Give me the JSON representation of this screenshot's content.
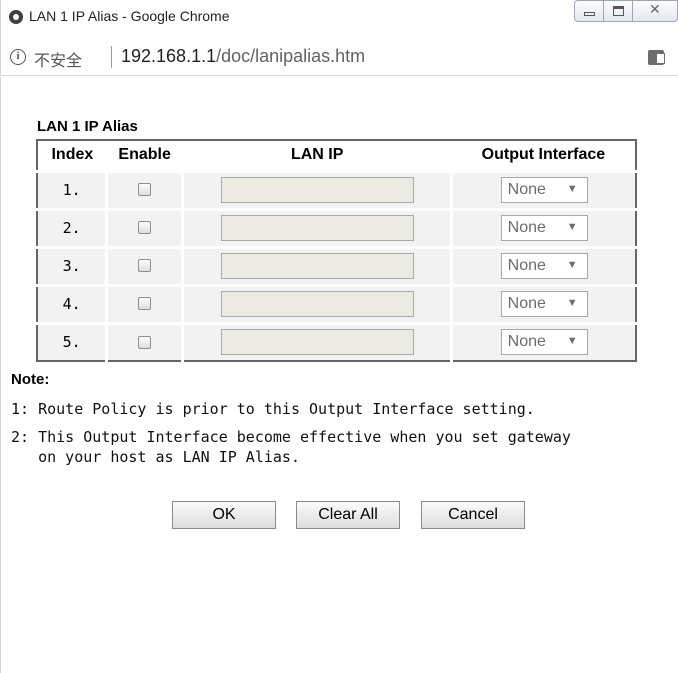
{
  "window": {
    "title": "LAN 1 IP Alias - Google Chrome",
    "minimize_label": "",
    "close_glyph": "✕"
  },
  "addressbar": {
    "security_text": "不安全",
    "url_host": "192.168.1.1",
    "url_path": "/doc/lanipalias.htm"
  },
  "page": {
    "section_title": "LAN 1 IP Alias",
    "columns": {
      "index": "Index",
      "enable": "Enable",
      "lan_ip": "LAN IP",
      "output": "Output Interface"
    },
    "rows": [
      {
        "index": "1.",
        "enabled": false,
        "lan_ip": "",
        "output": "None"
      },
      {
        "index": "2.",
        "enabled": false,
        "lan_ip": "",
        "output": "None"
      },
      {
        "index": "3.",
        "enabled": false,
        "lan_ip": "",
        "output": "None"
      },
      {
        "index": "4.",
        "enabled": false,
        "lan_ip": "",
        "output": "None"
      },
      {
        "index": "5.",
        "enabled": false,
        "lan_ip": "",
        "output": "None"
      }
    ],
    "note_title": "Note:",
    "note1": "1: Route Policy is prior to this Output Interface setting.",
    "note2": "2: This Output Interface become effective when you set gateway\n   on your host as LAN IP Alias.",
    "buttons": {
      "ok": "OK",
      "clear_all": "Clear All",
      "cancel": "Cancel"
    }
  }
}
